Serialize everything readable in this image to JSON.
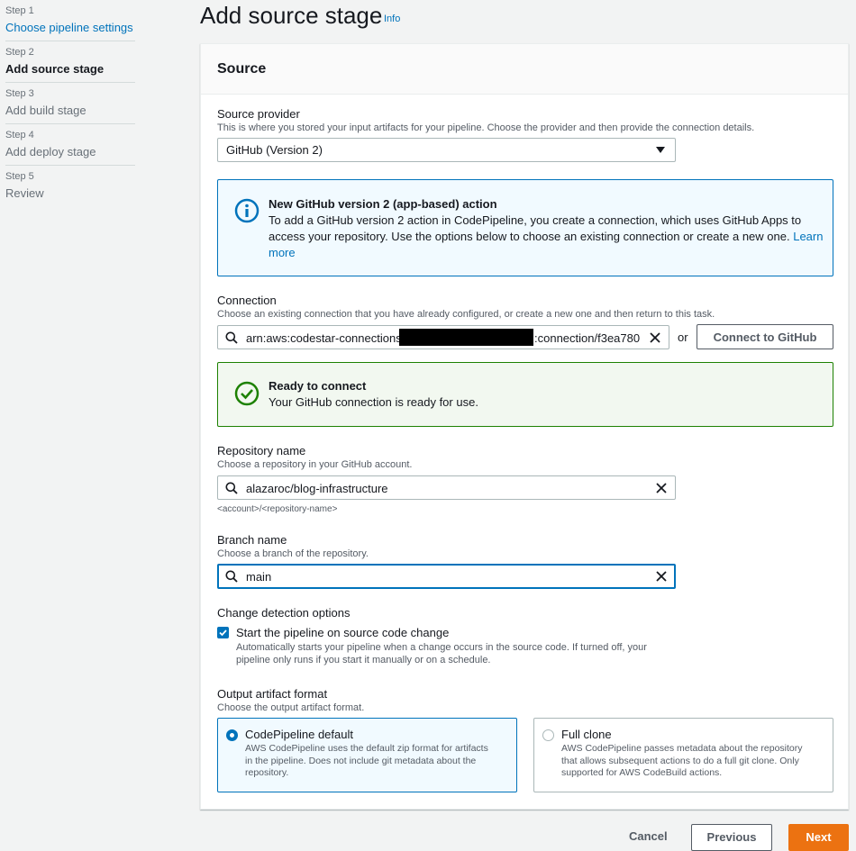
{
  "wizard": {
    "steps": [
      {
        "num": "Step 1",
        "title": "Choose pipeline settings"
      },
      {
        "num": "Step 2",
        "title": "Add source stage"
      },
      {
        "num": "Step 3",
        "title": "Add build stage"
      },
      {
        "num": "Step 4",
        "title": "Add deploy stage"
      },
      {
        "num": "Step 5",
        "title": "Review"
      }
    ]
  },
  "page": {
    "title": "Add source stage",
    "info": "Info"
  },
  "panel": {
    "title": "Source"
  },
  "source_provider": {
    "label": "Source provider",
    "description": "This is where you stored your input artifacts for your pipeline. Choose the provider and then provide the connection details.",
    "value": "GitHub (Version 2)"
  },
  "info_alert": {
    "title": "New GitHub version 2 (app-based) action",
    "line1": "To add a GitHub version 2 action in CodePipeline, you create a connection, which uses GitHub Apps to",
    "line2": "access your repository. Use the options below to choose an existing connection or create a new one.",
    "link_a": "Learn",
    "link_b": "more"
  },
  "connection": {
    "label": "Connection",
    "description": "Choose an existing connection that you have already configured, or create a new one and then return to this task.",
    "value_prefix": "arn:aws:codestar-connections:",
    "value_suffix": ":connection/f3ea780",
    "or_text": "or",
    "connect_button": "Connect to GitHub"
  },
  "success_alert": {
    "title": "Ready to connect",
    "body": "Your GitHub connection is ready for use."
  },
  "repository": {
    "label": "Repository name",
    "description": "Choose a repository in your GitHub account.",
    "value": "alazaroc/blog-infrastructure",
    "hint": "<account>/<repository-name>"
  },
  "branch": {
    "label": "Branch name",
    "description": "Choose a branch of the repository.",
    "value": "main"
  },
  "change_detection": {
    "label": "Change detection options",
    "checkbox_label": "Start the pipeline on source code change",
    "checked": true,
    "desc_line1": "Automatically starts your pipeline when a change occurs in the source code. If turned off, your",
    "desc_line2": "pipeline only runs if you start it manually or on a schedule."
  },
  "artifact": {
    "label": "Output artifact format",
    "description": "Choose the output artifact format.",
    "options": [
      {
        "title": "CodePipeline default",
        "selected": true,
        "desc": [
          "AWS CodePipeline uses the default zip format for artifacts",
          "in the pipeline. Does not include git metadata about the",
          "repository."
        ]
      },
      {
        "title": "Full clone",
        "selected": false,
        "desc": [
          "AWS CodePipeline passes metadata about the repository",
          "that allows subsequent actions to do a full git clone. Only",
          "supported for AWS CodeBuild actions."
        ]
      }
    ]
  },
  "footer": {
    "cancel": "Cancel",
    "previous": "Previous",
    "next": "Next"
  },
  "colors": {
    "accent": "#0073bb",
    "primary_button": "#ec7211",
    "success": "#1d8102"
  }
}
